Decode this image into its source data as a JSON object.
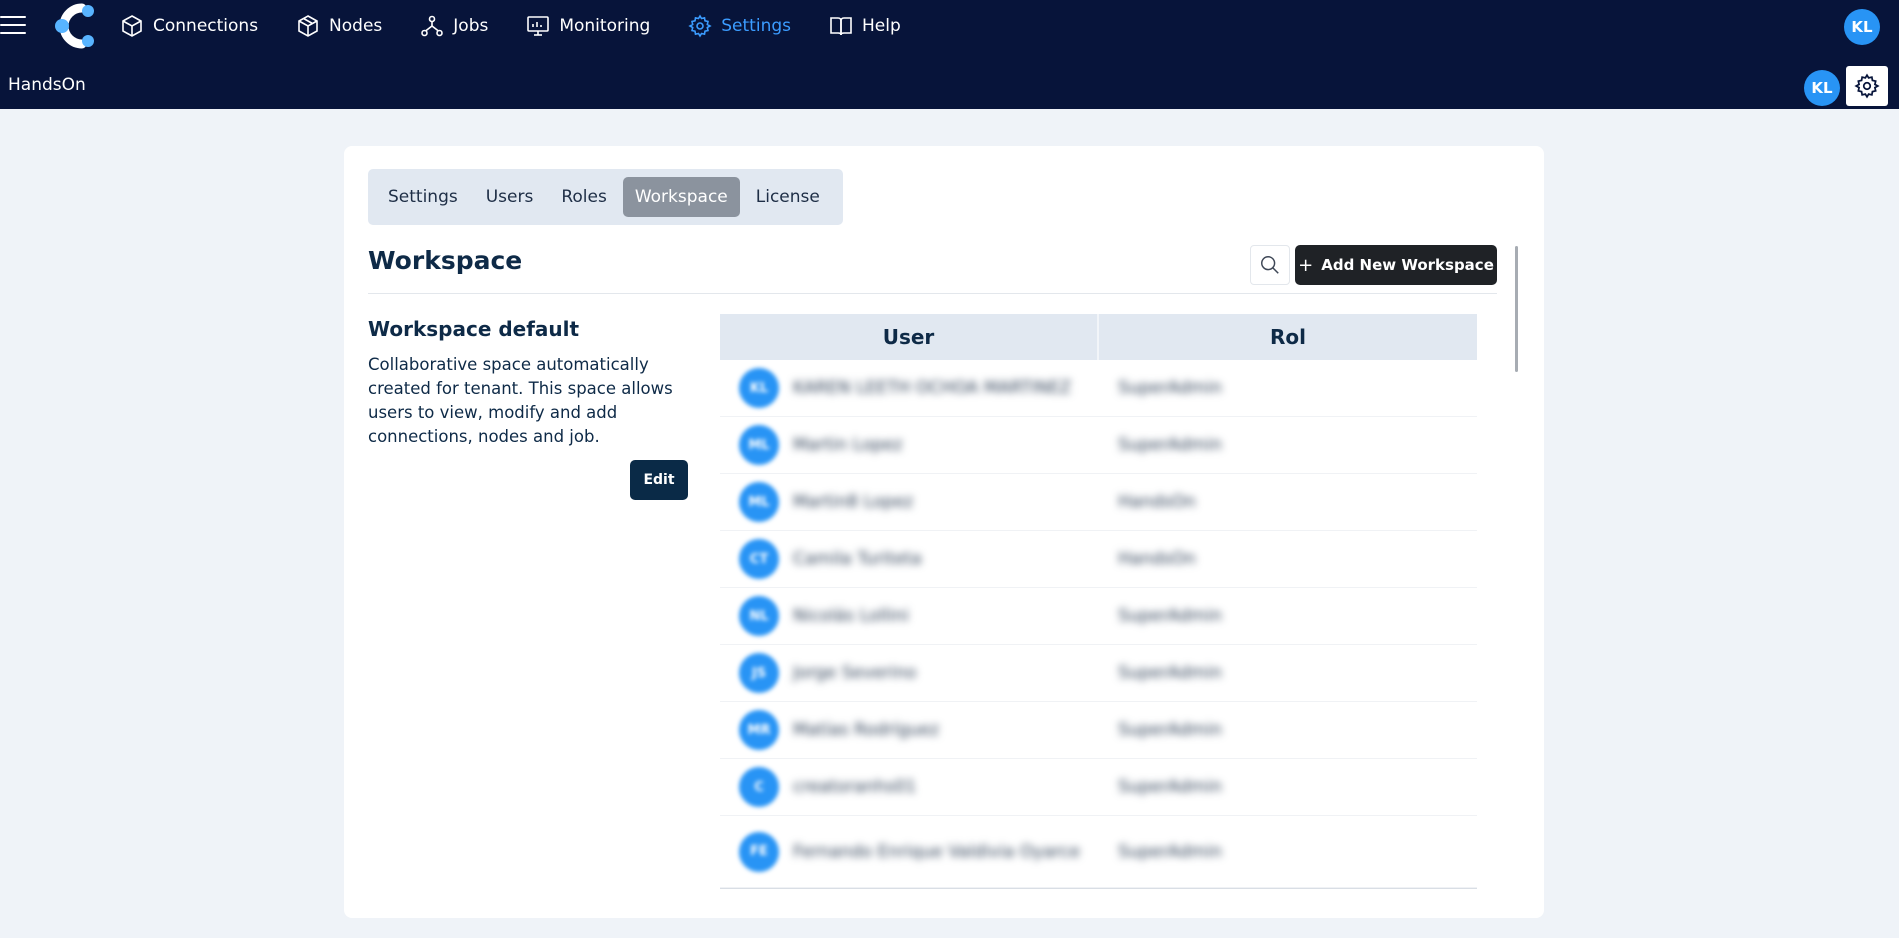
{
  "nav": {
    "items": [
      {
        "label": "Connections",
        "icon": "cube-icon"
      },
      {
        "label": "Nodes",
        "icon": "boxes-icon"
      },
      {
        "label": "Jobs",
        "icon": "nodes-graph-icon"
      },
      {
        "label": "Monitoring",
        "icon": "monitor-icon"
      },
      {
        "label": "Settings",
        "icon": "gear-icon",
        "active": true
      },
      {
        "label": "Help",
        "icon": "book-icon"
      }
    ],
    "user_initials": "KL"
  },
  "subheader": {
    "org_name": "HandsOn",
    "user_initials": "KL"
  },
  "tabs": [
    {
      "label": "Settings"
    },
    {
      "label": "Users"
    },
    {
      "label": "Roles"
    },
    {
      "label": "Workspace",
      "active": true
    },
    {
      "label": "License"
    }
  ],
  "page": {
    "title": "Workspace",
    "add_button_label": "Add New Workspace",
    "add_button_icon": "+"
  },
  "workspace": {
    "name": "Workspace default",
    "description": "Collaborative space automatically created for tenant. This space allows users to view, modify and add connections, nodes and job.",
    "edit_label": "Edit"
  },
  "table": {
    "columns": [
      "User",
      "Rol"
    ],
    "rows": [
      {
        "initials": "KL",
        "name": "KAREN LEETH OCHOA MARTINEZ",
        "role": "SuperAdmin"
      },
      {
        "initials": "ML",
        "name": "Martin Lopez",
        "role": "SuperAdmin"
      },
      {
        "initials": "ML",
        "name": "Martin8 Lopez",
        "role": "HandsOn"
      },
      {
        "initials": "CT",
        "name": "Camila Turiteta",
        "role": "HandsOn"
      },
      {
        "initials": "NL",
        "name": "Nicolás Lollini",
        "role": "SuperAdmin"
      },
      {
        "initials": "JS",
        "name": "Jorge Severino",
        "role": "SuperAdmin"
      },
      {
        "initials": "MR",
        "name": "Matías Rodríguez",
        "role": "SuperAdmin"
      },
      {
        "initials": "C",
        "name": "creatoranhs01",
        "role": "SuperAdmin"
      },
      {
        "initials": "FE",
        "name": "Fernando Enrique Valdivia Oyarce",
        "role": "SuperAdmin"
      }
    ]
  },
  "colors": {
    "topbar": "#07143a",
    "accent": "#3b9cff",
    "avatar": "#2894f5",
    "primary_button": "#1f2226",
    "edit_button": "#0a2a47"
  }
}
